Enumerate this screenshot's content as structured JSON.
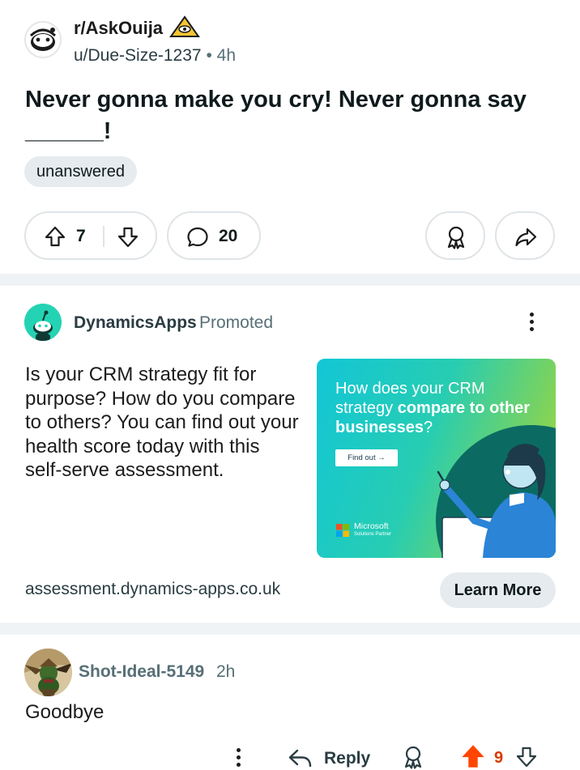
{
  "post": {
    "subreddit": "r/AskOuija",
    "author": "u/Due-Size-1237",
    "separator": "•",
    "age": "4h",
    "title": "Never gonna make you cry! Never gonna say ______!",
    "flair": "unanswered",
    "score": "7",
    "comment_count": "20",
    "icons": [
      "ouija-snoo-avatar",
      "pyramid-eye-icon",
      "upvote-icon",
      "downvote-icon",
      "comment-icon",
      "award-icon",
      "share-icon"
    ]
  },
  "ad": {
    "advertiser": "DynamicsApps",
    "label": "Promoted",
    "body": "Is your CRM strategy fit for purpose? How do you compare to others? You can find out your health score today with this self-serve assessment.",
    "image": {
      "headline_plain": "How does your CRM strategy ",
      "headline_bold": "compare to other businesses",
      "headline_end": "?",
      "cta": "Find out →",
      "partner_name": "Microsoft",
      "partner_sub": "Solutions Partner"
    },
    "url": "assessment.dynamics-apps.co.uk",
    "button": "Learn More",
    "accent": "#24d3b3"
  },
  "comment": {
    "author": "Shot-Ideal-5149",
    "age": "2h",
    "body": "Goodbye",
    "reply_label": "Reply",
    "score": "9",
    "upvote_color": "#ff4500"
  }
}
